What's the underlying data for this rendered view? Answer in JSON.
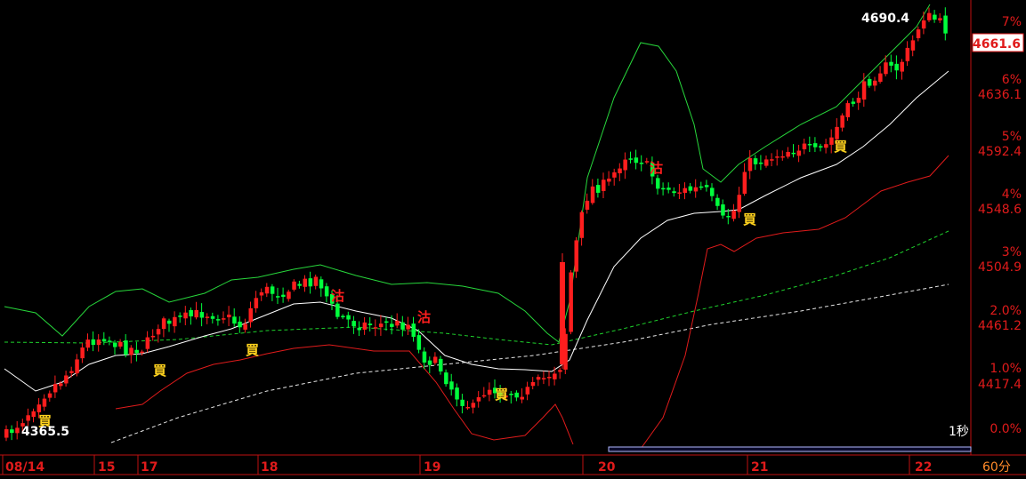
{
  "chart_data": {
    "type": "candlestick",
    "period_label": "60分",
    "speed_label": "1秒",
    "price_axis": {
      "ticks": [
        "4636.1",
        "4592.4",
        "4548.6",
        "4504.9",
        "4461.2",
        "4417.4"
      ],
      "ylim": [
        4365.5,
        4690.4
      ]
    },
    "percent_axis": {
      "ticks": [
        "0.0%",
        "1.0%",
        "2.0%",
        "3%",
        "4%",
        "5%",
        "6%",
        "7%"
      ]
    },
    "last_price": "4661.6",
    "high_label": "4690.4",
    "low_label": "4365.5",
    "dates": [
      "08/14",
      "15",
      "17",
      "18",
      "19",
      "20",
      "21",
      "22"
    ],
    "signals": {
      "buy_label": "買",
      "sell_label": "沽"
    },
    "colors": {
      "up": "#ff1e1e",
      "down": "#00ff3c",
      "upper_band": "#27d63b",
      "lower_band": "#e01b1b",
      "mid_band": "#ffffff",
      "ma_green": "#1ed22c",
      "ma_white": "#e6e6e6",
      "axis": "#c01010",
      "price_text": "#e01b1b",
      "buy_text": "#ffd21e"
    }
  }
}
